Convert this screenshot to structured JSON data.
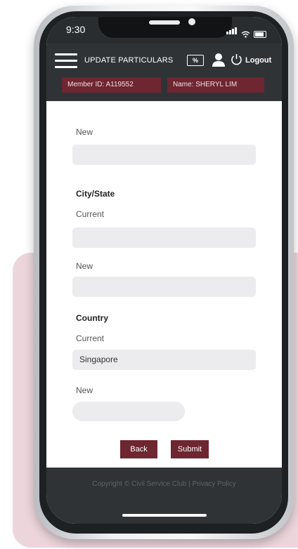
{
  "status_bar": {
    "time": "9:30"
  },
  "header": {
    "title": "UPDATE PARTICULARS",
    "discount_icon_glyph": "%",
    "logout_label": "Logout",
    "member_id": "Member ID: A119552",
    "member_name": "Name: SHERYL LIM"
  },
  "form": {
    "address_new_label": "New",
    "city_state": {
      "section_label": "City/State",
      "current_label": "Current",
      "current_value": "",
      "new_label": "New",
      "new_value": ""
    },
    "country": {
      "section_label": "Country",
      "current_label": "Current",
      "current_value": "Singapore",
      "new_label": "New",
      "new_value": ""
    }
  },
  "buttons": {
    "back": "Back",
    "submit": "Submit"
  },
  "footer": {
    "text": "Copyright © Civil Service Club | Privacy Policy"
  },
  "colors": {
    "accent": "#6e2630",
    "header_bg": "#303336",
    "decor_bg": "#ecd6dc"
  },
  "icons": [
    "hamburger-icon",
    "discount-icon",
    "user-icon",
    "power-icon",
    "signal-icon",
    "wifi-icon",
    "battery-icon"
  ]
}
